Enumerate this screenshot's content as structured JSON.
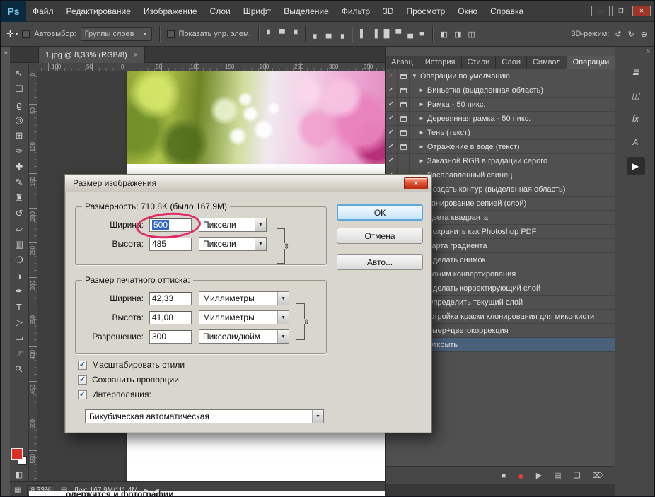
{
  "menubar": {
    "logo": "Ps",
    "items": [
      "Файл",
      "Редактирование",
      "Изображение",
      "Слои",
      "Шрифт",
      "Выделение",
      "Фильтр",
      "3D",
      "Просмотр",
      "Окно",
      "Справка"
    ]
  },
  "window_controls": [
    {
      "name": "minimize-button",
      "glyph": "—"
    },
    {
      "name": "restore-button",
      "glyph": "❐"
    },
    {
      "name": "close-button",
      "glyph": "✕",
      "close": true
    }
  ],
  "options": {
    "autoselect_label": "Автовыбор:",
    "autoselect_value": "Группы слоев",
    "show_label": "Показать упр. элем.",
    "mode_label": "3D-режим:",
    "icon_groups": [
      {
        "name": "align-top-icons",
        "glyphs": [
          "▘",
          "▀",
          "▝"
        ]
      },
      {
        "name": "align-bottom-icons",
        "glyphs": [
          "▖",
          "▄",
          "▗"
        ]
      },
      {
        "name": "distribute-icons",
        "glyphs": [
          "▌",
          "▐",
          "█",
          "▀",
          "▄",
          "■"
        ]
      },
      {
        "name": "arrange-icons",
        "glyphs": [
          "◧",
          "◨",
          "◫"
        ]
      }
    ],
    "mode_icons": [
      {
        "name": "3d-orbit-icon",
        "glyph": "↺"
      },
      {
        "name": "3d-roll-icon",
        "glyph": "↻"
      },
      {
        "name": "3d-pan-icon",
        "glyph": "⊕"
      }
    ]
  },
  "doc_tab": {
    "title": "1.jpg @ 8,33% (RGB/8)"
  },
  "rulers": {
    "h": [
      "100",
      "50",
      "0",
      "50",
      "100",
      "150",
      "200",
      "250",
      "300",
      "350"
    ],
    "v": [
      "0",
      "50",
      "100",
      "150",
      "200",
      "250",
      "300",
      "350",
      "400",
      "450",
      "500",
      "550"
    ]
  },
  "tools": [
    {
      "name": "move-tool",
      "glyph": "↖"
    },
    {
      "name": "marquee-tool",
      "glyph": "☐"
    },
    {
      "name": "lasso-tool",
      "glyph": "ϱ"
    },
    {
      "name": "quick-selection-tool",
      "glyph": "◎"
    },
    {
      "name": "crop-tool",
      "glyph": "⊞"
    },
    {
      "name": "eyedropper-tool",
      "glyph": "✑"
    },
    {
      "name": "healing-brush-tool",
      "glyph": "✚"
    },
    {
      "name": "brush-tool",
      "glyph": "✎"
    },
    {
      "name": "clone-stamp-tool",
      "glyph": "♜"
    },
    {
      "name": "history-brush-tool",
      "glyph": "↺"
    },
    {
      "name": "eraser-tool",
      "glyph": "▱"
    },
    {
      "name": "gradient-tool",
      "glyph": "▥"
    },
    {
      "name": "blur-tool",
      "glyph": "❍"
    },
    {
      "name": "dodge-tool",
      "glyph": "◑"
    },
    {
      "name": "pen-tool",
      "glyph": "✒"
    },
    {
      "name": "type-tool",
      "glyph": "T"
    },
    {
      "name": "path-selection-tool",
      "glyph": "▷"
    },
    {
      "name": "shape-tool",
      "glyph": "▭"
    },
    {
      "name": "hand-tool",
      "glyph": "☞"
    },
    {
      "name": "zoom-tool",
      "glyph": "⚲"
    }
  ],
  "dialog": {
    "title": "Размер изображения",
    "pixel_group_label": "Размерность:",
    "pixel_group_value": "710,8K (было 167,9M)",
    "width_label": "Ширина:",
    "width_value": "500",
    "width_unit": "Пиксели",
    "height_label": "Высота:",
    "height_value": "485",
    "height_unit": "Пиксели",
    "print_group_label": "Размер печатного оттиска:",
    "print_width_label": "Ширина:",
    "print_width_value": "42,33",
    "print_width_unit": "Миллиметры",
    "print_height_label": "Высота:",
    "print_height_value": "41,08",
    "print_height_unit": "Миллиметры",
    "resolution_label": "Разрешение:",
    "resolution_value": "300",
    "resolution_unit": "Пиксели/дюйм",
    "checkboxes": [
      {
        "label": "Масштабировать стили",
        "checked": true
      },
      {
        "label": "Сохранить пропорции",
        "checked": true
      },
      {
        "label": "Интерполяция:",
        "checked": true
      }
    ],
    "resample_value": "Бикубическая автоматическая",
    "buttons": {
      "ok": "ОК",
      "cancel": "Отмена",
      "auto": "Авто..."
    },
    "annotation_color": "#e02a6a"
  },
  "panels": {
    "tabs": [
      {
        "name": "tab-paragraph",
        "label": "Абзац"
      },
      {
        "name": "tab-history",
        "label": "История"
      },
      {
        "name": "tab-styles",
        "label": "Стили"
      },
      {
        "name": "tab-layers",
        "label": "Слои"
      },
      {
        "name": "tab-character",
        "label": "Символ"
      },
      {
        "name": "tab-actions",
        "label": "Операции",
        "active": true
      }
    ],
    "actions": [
      {
        "label": "Операции по умолчанию",
        "check": "red",
        "modal": true,
        "tri": "down",
        "indent": 0
      },
      {
        "label": "Виньетка (выделенная область)",
        "check": "on",
        "modal": true,
        "tri": "right",
        "indent": 1
      },
      {
        "label": "Рамка - 50 пикс.",
        "check": "on",
        "modal": true,
        "tri": "right",
        "indent": 1
      },
      {
        "label": "Деревянная рамка - 50 пикс.",
        "check": "on",
        "modal": true,
        "tri": "right",
        "indent": 1
      },
      {
        "label": "Тень (текст)",
        "check": "on",
        "modal": true,
        "tri": "right",
        "indent": 1
      },
      {
        "label": "Отражение в воде (текст)",
        "check": "on",
        "modal": true,
        "tri": "right",
        "indent": 1
      },
      {
        "label": "Заказной RGB в градации серого",
        "check": "on",
        "modal": false,
        "tri": "right",
        "indent": 1
      },
      {
        "label": "Расплавленный свинец",
        "check": "on",
        "modal": false,
        "tri": "right",
        "indent": 1
      },
      {
        "label": "Создать контур (выделенная область)",
        "check": "on",
        "modal": false,
        "tri": "right",
        "indent": 1
      },
      {
        "label": "Тонирование сепией (слой)",
        "check": "on",
        "modal": false,
        "tri": "right",
        "indent": 1
      },
      {
        "label": "Цвета квадранта",
        "check": "on",
        "modal": false,
        "tri": "right",
        "indent": 1
      },
      {
        "label": "Сохранить как Photoshop PDF",
        "check": "on",
        "modal": false,
        "tri": "right",
        "indent": 1
      },
      {
        "label": "Карта градиента",
        "check": "on",
        "modal": false,
        "tri": "right",
        "indent": 1
      },
      {
        "label": "Сделать снимок",
        "check": "on",
        "modal": false,
        "tri": "right",
        "indent": 1
      },
      {
        "label": "Режим конвертирования",
        "check": "on",
        "modal": true,
        "tri": "right",
        "indent": 1
      },
      {
        "label": "Сделать корректирующий слой",
        "check": "on",
        "modal": false,
        "tri": "right",
        "indent": 1
      },
      {
        "label": "Определить текущий слой",
        "check": "on",
        "modal": false,
        "tri": "right",
        "indent": 1
      },
      {
        "label": "Настройка краски клонирования для микс-кисти",
        "check": "on",
        "modal": false,
        "tri": "right",
        "indent": 0
      },
      {
        "label": "размер+цветокоррекция",
        "check": "none",
        "modal": false,
        "tri": "down",
        "indent": 0
      },
      {
        "label": "Открыть",
        "check": "none",
        "modal": false,
        "tri": "right",
        "indent": 1,
        "selected": true
      }
    ],
    "footer_icons": [
      {
        "name": "stop-icon",
        "glyph": "■"
      },
      {
        "name": "record-icon",
        "glyph": "●",
        "record": true
      },
      {
        "name": "play-icon",
        "glyph": "▶"
      },
      {
        "name": "new-set-folder-icon",
        "glyph": "▤"
      },
      {
        "name": "new-action-icon",
        "glyph": "❏"
      },
      {
        "name": "delete-icon",
        "glyph": "⌦"
      }
    ]
  },
  "dock_icons": [
    {
      "name": "history-panel-icon",
      "glyph": "≣"
    },
    {
      "name": "properties-panel-icon",
      "glyph": "◫"
    },
    {
      "name": "styles-panel-icon",
      "glyph": "fx"
    },
    {
      "name": "character-panel-icon",
      "glyph": "A"
    },
    {
      "name": "collapse-panel-icon",
      "glyph": "▶",
      "pressed": true
    }
  ],
  "statusbar": {
    "zoom": "8,33%",
    "doc_info": "Док: 167,9M/111,4M"
  },
  "page_text": "одержится и фотографии",
  "icons": {
    "move_tool": "✛",
    "chevron_down": "▼",
    "chevron_down_small": "▾",
    "check": "✓",
    "link": "∞",
    "collapse_left": "»",
    "collapse_right": "«",
    "panel_menu": "≡",
    "status_play": "▶",
    "status_back": "◀",
    "workspace_grid": "▦",
    "doc_page": "▤",
    "quick_mask": "◧",
    "screen_mode": "▢",
    "tab_close": "×",
    "dialog_close": "✕"
  }
}
